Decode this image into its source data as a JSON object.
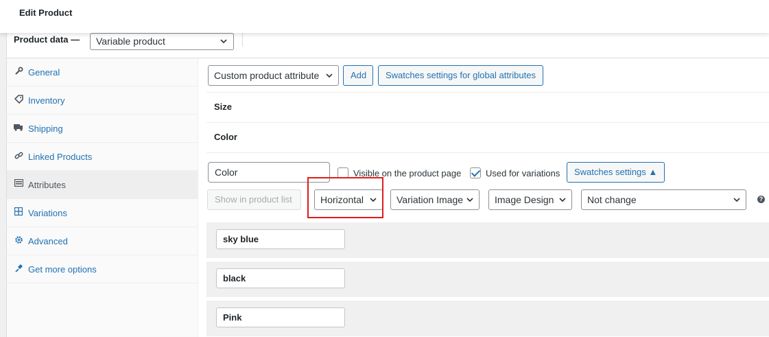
{
  "header": {
    "title": "Edit Product"
  },
  "product_data": {
    "label": "Product data —",
    "type_selected": "Variable product"
  },
  "tabs": [
    {
      "label": "General",
      "icon": "wrench-icon"
    },
    {
      "label": "Inventory",
      "icon": "tag-icon"
    },
    {
      "label": "Shipping",
      "icon": "truck-icon"
    },
    {
      "label": "Linked Products",
      "icon": "link-icon"
    },
    {
      "label": "Attributes",
      "icon": "list-icon"
    },
    {
      "label": "Variations",
      "icon": "grid-icon"
    },
    {
      "label": "Advanced",
      "icon": "gear-icon"
    },
    {
      "label": "Get more options",
      "icon": "plugin-icon"
    }
  ],
  "attributes_toolbar": {
    "attribute_select": "Custom product attribute",
    "add_label": "Add",
    "swatches_global_label": "Swatches settings for global attributes"
  },
  "attributes": [
    {
      "name": "Size"
    },
    {
      "name": "Color"
    }
  ],
  "color_attribute": {
    "name_value": "Color",
    "visible_label": "Visible on the product page",
    "visible_checked": false,
    "variations_label": "Used for variations",
    "variations_checked": true,
    "swatches_settings_label": "Swatches settings ▲",
    "show_in_list_label": "Show in product list",
    "layout_select": "Horizontal",
    "type_select": "Variation Image",
    "design_select": "Image Design",
    "change_select": "Not change",
    "help": "?"
  },
  "terms": [
    {
      "value": "sky blue"
    },
    {
      "value": "black"
    },
    {
      "value": "Pink"
    }
  ],
  "colors": {
    "accent": "#2271b1",
    "highlight": "#e01b1b"
  }
}
